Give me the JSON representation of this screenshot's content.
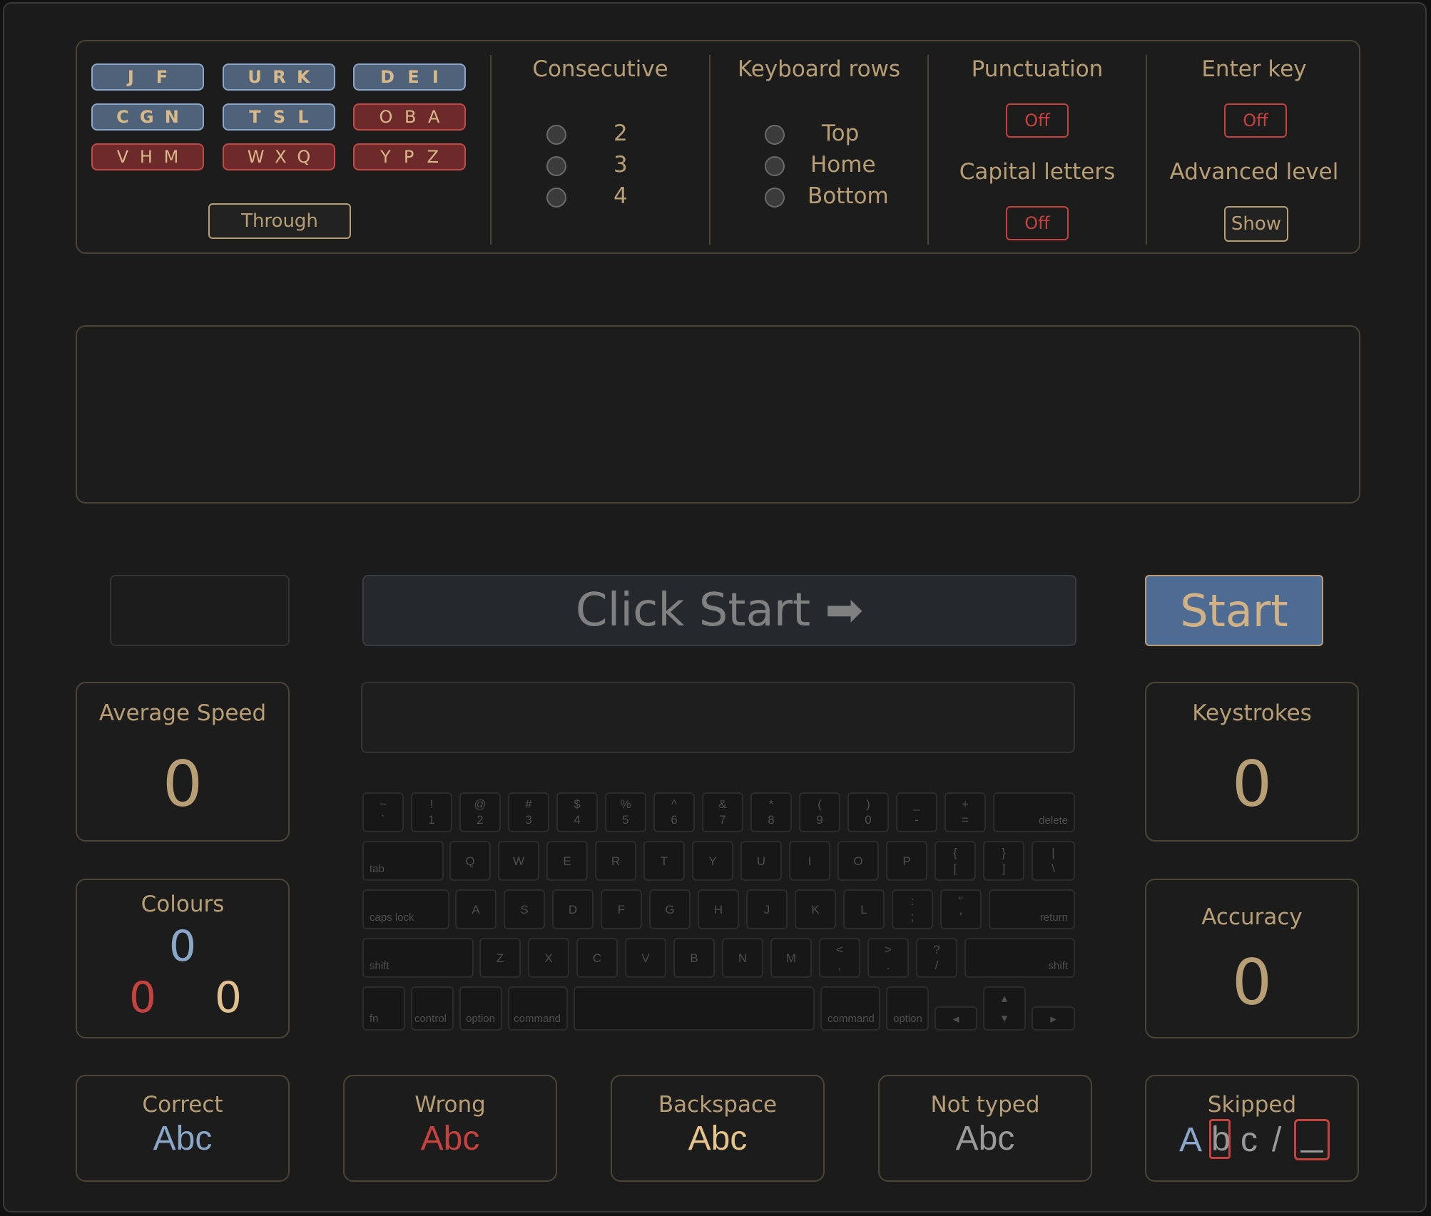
{
  "letter_groups": [
    {
      "letters": [
        "J",
        "F"
      ],
      "state": "on"
    },
    {
      "letters": [
        "U",
        "R",
        "K"
      ],
      "state": "on"
    },
    {
      "letters": [
        "D",
        "E",
        "I"
      ],
      "state": "on"
    },
    {
      "letters": [
        "C",
        "G",
        "N"
      ],
      "state": "on"
    },
    {
      "letters": [
        "T",
        "S",
        "L"
      ],
      "state": "on"
    },
    {
      "letters": [
        "O",
        "B",
        "A"
      ],
      "state": "off"
    },
    {
      "letters": [
        "V",
        "H",
        "M"
      ],
      "state": "off"
    },
    {
      "letters": [
        "W",
        "X",
        "Q"
      ],
      "state": "off"
    },
    {
      "letters": [
        "Y",
        "P",
        "Z"
      ],
      "state": "off"
    }
  ],
  "through_label": "Through",
  "consecutive": {
    "title": "Consecutive",
    "options": [
      "2",
      "3",
      "4"
    ]
  },
  "keyboard_rows": {
    "title": "Keyboard rows",
    "options": [
      "Top",
      "Home",
      "Bottom"
    ]
  },
  "punctuation": {
    "title": "Punctuation",
    "value": "Off"
  },
  "capital_letters": {
    "title": "Capital letters",
    "value": "Off"
  },
  "enter_key": {
    "title": "Enter key",
    "value": "Off"
  },
  "advanced_level": {
    "title": "Advanced level",
    "button": "Show"
  },
  "prompt": {
    "text": "Click Start ➡"
  },
  "start_label": "Start",
  "stats": {
    "average_speed": {
      "title": "Average Speed",
      "value": "0"
    },
    "keystrokes": {
      "title": "Keystrokes",
      "value": "0"
    },
    "colours": {
      "title": "Colours",
      "blue": "0",
      "red": "0",
      "gold": "0"
    },
    "accuracy": {
      "title": "Accuracy",
      "value": "0"
    }
  },
  "legend": {
    "correct": {
      "title": "Correct",
      "sample": "Abc"
    },
    "wrong": {
      "title": "Wrong",
      "sample": "Abc"
    },
    "backspace": {
      "title": "Backspace",
      "sample": "Abc"
    },
    "not_typed": {
      "title": "Not typed",
      "sample": "Abc"
    },
    "skipped": {
      "title": "Skipped",
      "a": "A",
      "b": "b",
      "c": "c",
      "slash": "/"
    }
  },
  "keyboard": {
    "number_row": [
      [
        "~",
        "`"
      ],
      [
        "!",
        "1"
      ],
      [
        "@",
        "2"
      ],
      [
        "#",
        "3"
      ],
      [
        "$",
        "4"
      ],
      [
        "%",
        "5"
      ],
      [
        "^",
        "6"
      ],
      [
        "&",
        "7"
      ],
      [
        "*",
        "8"
      ],
      [
        "(",
        "9"
      ],
      [
        ")",
        "0"
      ],
      [
        "_",
        "-"
      ],
      [
        "+",
        "="
      ]
    ],
    "delete": "delete",
    "tab": "tab",
    "qwerty": [
      "Q",
      "W",
      "E",
      "R",
      "T",
      "Y",
      "U",
      "I",
      "O",
      "P"
    ],
    "qwerty_brackets": [
      [
        "{",
        "["
      ],
      [
        "}",
        "]"
      ],
      [
        "|",
        "\\"
      ]
    ],
    "caps": "caps lock",
    "home": [
      "A",
      "S",
      "D",
      "F",
      "G",
      "H",
      "J",
      "K",
      "L"
    ],
    "home_punct": [
      [
        ":",
        ";"
      ],
      [
        "\"",
        "'"
      ]
    ],
    "return": "return",
    "shift": "shift",
    "bottom": [
      "Z",
      "X",
      "C",
      "V",
      "B",
      "N",
      "M"
    ],
    "bottom_punct": [
      [
        "<",
        ","
      ],
      [
        ">",
        "."
      ],
      [
        "?",
        "/"
      ]
    ],
    "fn": "fn",
    "control": "control",
    "option": "option",
    "command": "command",
    "arrow_left": "◂",
    "arrow_up": "▴",
    "arrow_down": "▾",
    "arrow_right": "▸"
  },
  "colors": {
    "accent_blue": "#8aa6c8",
    "wrong_red": "#c6423f",
    "gold": "#b89e74",
    "start_blue": "#4e6b93"
  }
}
